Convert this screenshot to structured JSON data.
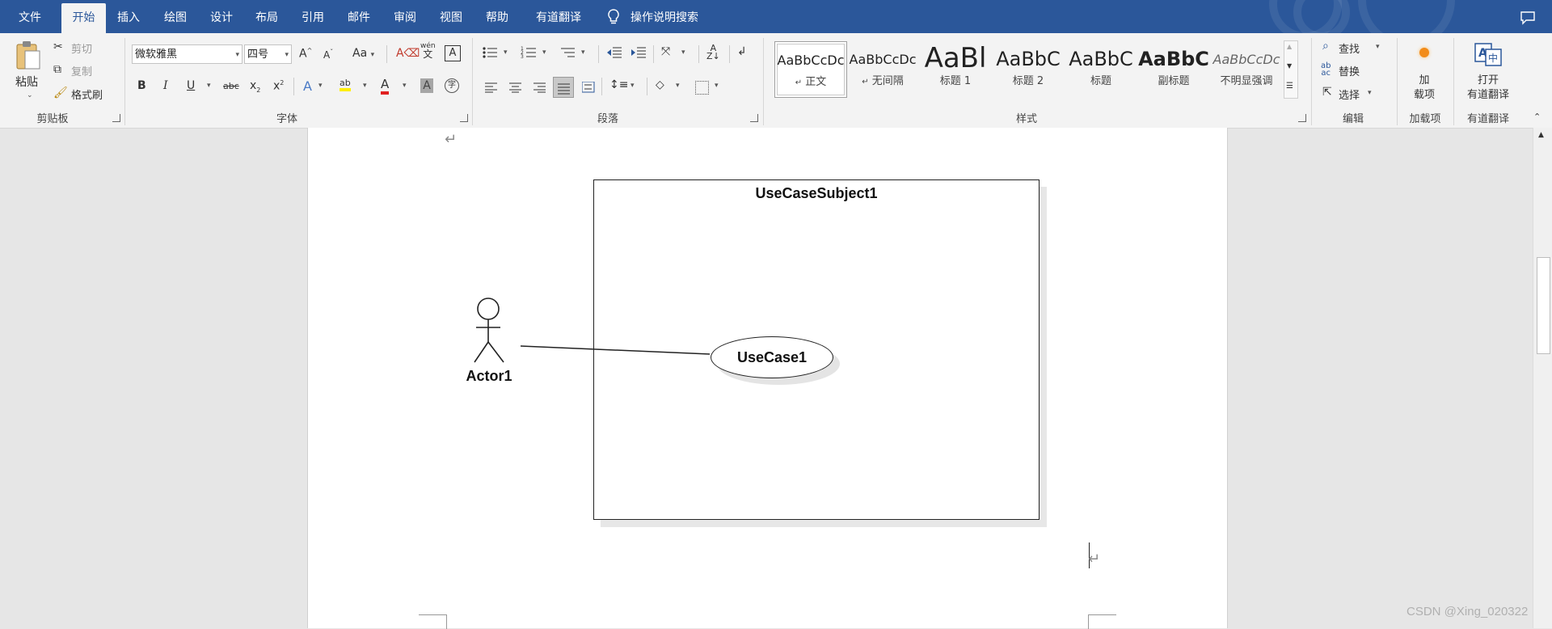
{
  "menubar": {
    "tabs": [
      "文件",
      "开始",
      "插入",
      "绘图",
      "设计",
      "布局",
      "引用",
      "邮件",
      "审阅",
      "视图",
      "帮助",
      "有道翻译"
    ],
    "active_tab": "开始",
    "tell_me": "操作说明搜索"
  },
  "clipboard": {
    "paste": "粘贴",
    "cut": "剪切",
    "copy": "复制",
    "format_painter": "格式刷",
    "group_label": "剪贴板"
  },
  "font": {
    "font_name": "微软雅黑",
    "font_size": "四号",
    "grow": "A",
    "shrink": "A",
    "change_case": "Aa",
    "bold": "B",
    "italic": "I",
    "underline": "U",
    "strikethrough": "abc",
    "subscript": "x",
    "superscript": "x",
    "highlight": "ab",
    "font_color": "A",
    "char_shading": "A",
    "phonetic_top": "wén",
    "phonetic_bottom": "文",
    "char_border": "A",
    "enclose": "字",
    "group_label": "字体"
  },
  "paragraph": {
    "group_label": "段落"
  },
  "styles": {
    "items": [
      {
        "preview": "AaBbCcDc",
        "name": "正文",
        "para_mark": "↵"
      },
      {
        "preview": "AaBbCcDc",
        "name": "无间隔",
        "para_mark": "↵"
      },
      {
        "preview": "AaBl",
        "name": "标题 1"
      },
      {
        "preview": "AaBbC",
        "name": "标题 2"
      },
      {
        "preview": "AaBbC",
        "name": "标题"
      },
      {
        "preview": "AaBbC",
        "name": "副标题"
      },
      {
        "preview": "AaBbCcDc",
        "name": "不明显强调"
      }
    ],
    "group_label": "样式"
  },
  "editing": {
    "find": "查找",
    "replace": "替换",
    "select": "选择",
    "group_label": "编辑"
  },
  "addins": {
    "button_line1": "加",
    "button_line2": "载项",
    "group_label": "加载项"
  },
  "youdao": {
    "button_line1": "打开",
    "button_line2": "有道翻译",
    "group_label": "有道翻译"
  },
  "document": {
    "paragraph_mark": "↵",
    "diagram": {
      "subject": "UseCaseSubject1",
      "use_case": "UseCase1",
      "actor": "Actor1"
    }
  },
  "watermark": "CSDN @Xing_020322"
}
